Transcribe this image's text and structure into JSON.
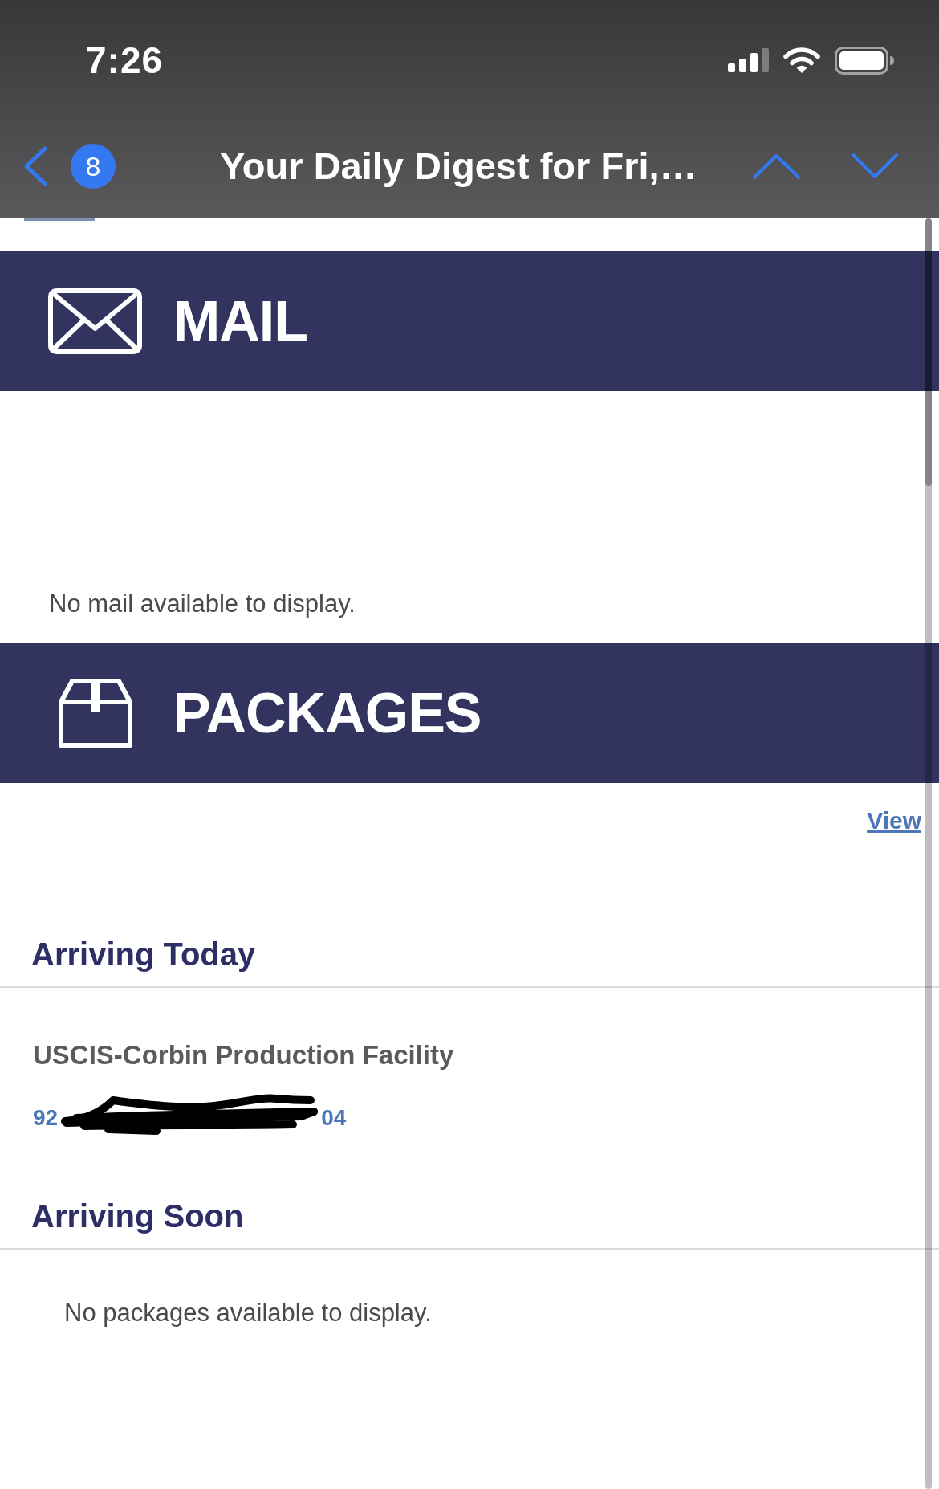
{
  "status_bar": {
    "time": "7:26"
  },
  "nav_bar": {
    "unread_count": "8",
    "title": "Your Daily Digest for Fri,…"
  },
  "sections": [
    {
      "kind": "mail",
      "title": "MAIL",
      "empty_message": "No mail available to display."
    },
    {
      "kind": "packages",
      "title": "PACKAGES",
      "link": "View",
      "groups": [
        {
          "heading": "Arriving Today",
          "packages": [
            {
              "sender": "USCIS-Corbin Production Facility",
              "tracking_start": "92",
              "tracking_end": "04",
              "redacted": true
            }
          ]
        },
        {
          "heading": "Arriving Soon",
          "empty_message": "No packages available to display."
        }
      ]
    }
  ]
}
